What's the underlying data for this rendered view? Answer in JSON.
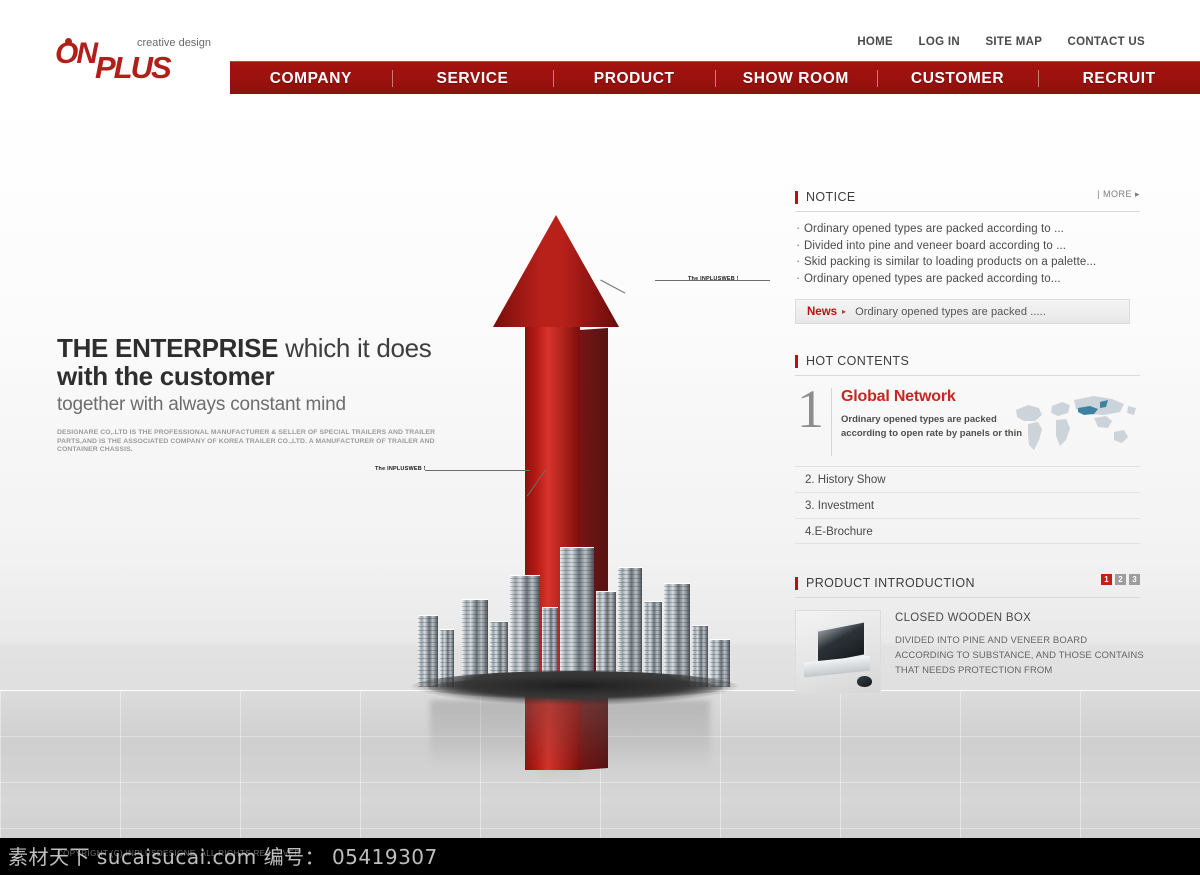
{
  "header": {
    "logo": {
      "on": "ON",
      "plus": "PLUS",
      "tagline": "creative design"
    },
    "top_links": [
      "HOME",
      "LOG IN",
      "SITE MAP",
      "CONTACT US"
    ],
    "nav": [
      "COMPANY",
      "SERVICE",
      "PRODUCT",
      "SHOW ROOM",
      "CUSTOMER",
      "RECRUIT"
    ],
    "accent_color": "#a5130f"
  },
  "hero": {
    "headline_line1_bold": "THE ENTERPRISE",
    "headline_line1_rest": " which it does",
    "headline_line2": "with the customer",
    "subheadline": "together with always constant mind",
    "paragraph": "DESIGNARE  CO,.LTD IS THE PROFESSIONAL MANUFACTURER & SELLER OF SPECIAL TRAILERS AND TRAILER PARTS,AND IS THE ASSOCIATED COMPANY OF KOREA TRAILER CO.,LTD. A MANUFACTURER OF TRAILER AND CONTAINER CHASSIS.",
    "callout_top": "The INPLUSWEB !",
    "callout_bottom": "The INPLUSWEB !"
  },
  "notice": {
    "title": "NOTICE",
    "more": "| MORE ▸",
    "items": [
      "Ordinary opened types are packed according to ...",
      "Divided into pine and veneer board according to ...",
      "Skid packing is similar to loading products on a palette...",
      "Ordinary opened types are packed according to..."
    ]
  },
  "news": {
    "label": "News",
    "arrow": "▸",
    "text": "Ordinary opened types are packed ....."
  },
  "hot_contents": {
    "title": "HOT CONTENTS",
    "feature": {
      "number": "1",
      "title": "Global Network",
      "description": "Ordinary opened types are packed according to open rate by panels or thin"
    },
    "rows": [
      "2. History Show",
      "3. Investment",
      "4.E-Brochure"
    ]
  },
  "product_introduction": {
    "title": "PRODUCT INTRODUCTION",
    "pages": [
      "1",
      "2",
      "3"
    ],
    "active_page": "1",
    "item_title": "CLOSED WOODEN BOX",
    "item_description": "DIVIDED INTO PINE AND VENEER BOARD ACCORDING TO SUBSTANCE, AND THOSE CONTAINS THAT NEEDS PROTECTION FROM",
    "thumbnail_icon": "laptop-icon"
  },
  "footer": {
    "copyright": "COPYRIGHT (C) INPLUSDESIGNE. ALL RIGHTS RESERVED",
    "watermark": "素材天下 sucaisucai.com 编号： 05419307"
  }
}
